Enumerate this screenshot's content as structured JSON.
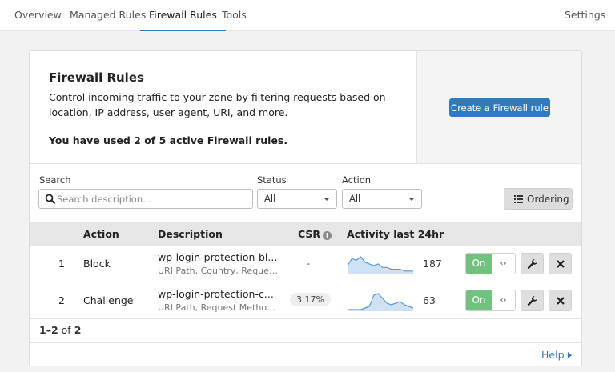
{
  "nav": {
    "tabs": [
      {
        "label": "Overview",
        "active": false
      },
      {
        "label": "Managed Rules",
        "active": false
      },
      {
        "label": "Firewall Rules",
        "active": true
      },
      {
        "label": "Tools",
        "active": false
      }
    ],
    "settings_label": "Settings"
  },
  "hero": {
    "title": "Firewall Rules",
    "description": "Control incoming traffic to your zone by filtering requests based on location, IP address, user agent, URI, and more.",
    "usage": "You have used 2 of 5 active Firewall rules.",
    "create_label": "Create a Firewall rule"
  },
  "filters": {
    "search_label": "Search",
    "search_placeholder": "Search description...",
    "search_value": "",
    "status_label": "Status",
    "status_value": "All",
    "action_label": "Action",
    "action_value": "All",
    "ordering_label": "Ordering"
  },
  "table": {
    "columns": [
      "Action",
      "Description",
      "CSR",
      "Activity last 24hr"
    ],
    "rows": [
      {
        "index": "1",
        "action": "Block",
        "description": "wp-login-protection-bl...",
        "fields": "URI Path, Country, Request...",
        "csr": "-",
        "count": "187",
        "toggle": "On",
        "activity": [
          4,
          8,
          7,
          9,
          6,
          5,
          4,
          5,
          3,
          3,
          2,
          2,
          2,
          1,
          1,
          1
        ]
      },
      {
        "index": "2",
        "action": "Challenge",
        "description": "wp-login-protection-c...",
        "fields": "URI Path, Request Method,...",
        "csr": "3.17%",
        "count": "63",
        "toggle": "On",
        "activity": [
          0,
          0,
          0,
          0,
          1,
          2,
          9,
          10,
          7,
          4,
          3,
          4,
          5,
          3,
          2,
          1
        ]
      }
    ]
  },
  "pager": {
    "range": "1–2",
    "of": "of",
    "total": "2"
  },
  "help_label": "Help",
  "colors": {
    "accent": "#2f7bbf",
    "toggle_on": "#71c27e",
    "sparkline": "#5b9bd5"
  }
}
